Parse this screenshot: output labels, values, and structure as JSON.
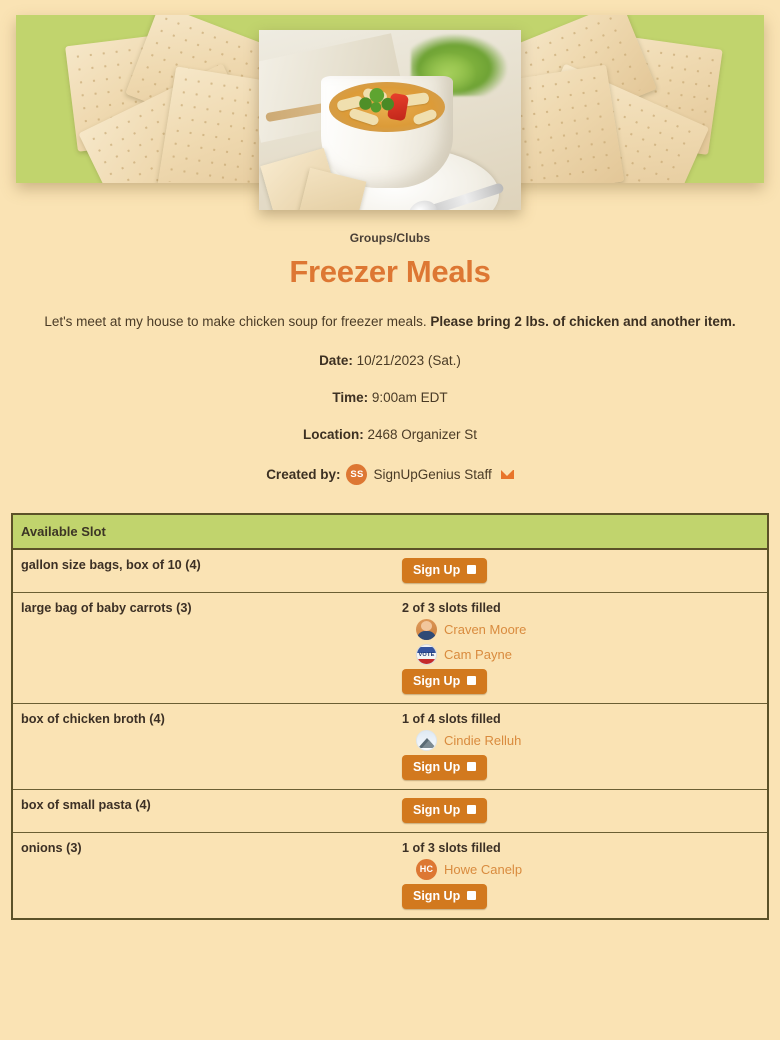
{
  "banner": {
    "alt": "chicken-noodle-soup-with-crackers-banner",
    "background_color": "#c1d46d"
  },
  "header": {
    "category": "Groups/Clubs",
    "title": "Freezer Meals",
    "description_plain": "Let's meet at my house to make chicken soup for freezer meals.",
    "description_bold": "Please bring 2 lbs. of chicken and another item."
  },
  "details": {
    "date_label": "Date:",
    "date_value": "10/21/2023 (Sat.)",
    "time_label": "Time:",
    "time_value": "9:00am EDT",
    "location_label": "Location:",
    "location_value": "2468 Organizer St",
    "created_by_label": "Created by:",
    "creator_initials": "SS",
    "creator_name": "SignUpGenius Staff",
    "creator_email_icon": "envelope-icon"
  },
  "table": {
    "header": "Available Slot",
    "signup_label": "Sign Up",
    "rows": [
      {
        "slot": "gallon size bags, box of 10 (4)",
        "filled_text": null,
        "participants": []
      },
      {
        "slot": "large bag of baby carrots (3)",
        "filled_text": "2 of 3 slots filled",
        "participants": [
          {
            "name": "Craven Moore",
            "avatar": "photo-portrait-avatar"
          },
          {
            "name": "Cam Payne",
            "avatar": "vote-badge-avatar"
          }
        ]
      },
      {
        "slot": "box of chicken broth (4)",
        "filled_text": "1 of 4 slots filled",
        "participants": [
          {
            "name": "Cindie Relluh",
            "avatar": "landscape-photo-avatar"
          }
        ]
      },
      {
        "slot": "box of small pasta (4)",
        "filled_text": null,
        "participants": []
      },
      {
        "slot": "onions (3)",
        "filled_text": "1 of 3 slots filled",
        "participants": [
          {
            "name": "Howe Canelp",
            "avatar": "initials-avatar",
            "initials": "HC"
          }
        ]
      }
    ]
  },
  "colors": {
    "page_background": "#fae3b4",
    "banner_green": "#c1d467",
    "title_orange": "#dd7733",
    "button_orange": "#d2791e",
    "participant_link": "#d98b3e",
    "table_border": "#5b5128"
  }
}
